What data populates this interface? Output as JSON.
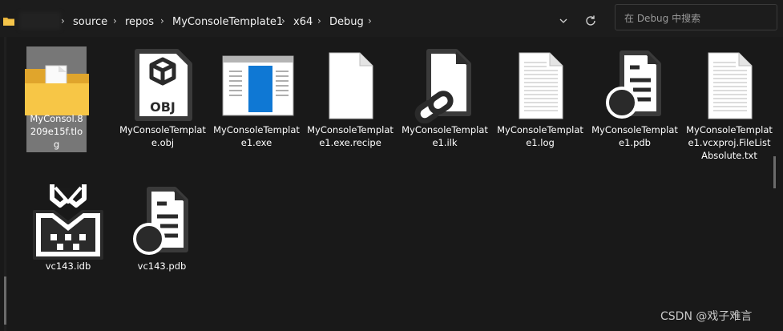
{
  "breadcrumb": {
    "items": [
      "source",
      "repos",
      "MyConsoleTemplate1",
      "x64",
      "Debug"
    ]
  },
  "search": {
    "placeholder": "在 Debug 中搜索"
  },
  "files": [
    {
      "name": "MyConsol.8209e15f.tlog",
      "icon": "folder-icon",
      "selected": true
    },
    {
      "name": "MyConsoleTemplate.obj",
      "icon": "obj-file-icon",
      "selected": false
    },
    {
      "name": "MyConsoleTemplate1.exe",
      "icon": "exe-file-icon",
      "selected": false
    },
    {
      "name": "MyConsoleTemplate1.exe.recipe",
      "icon": "blank-file-icon",
      "selected": false
    },
    {
      "name": "MyConsoleTemplate1.ilk",
      "icon": "linked-file-icon",
      "selected": false
    },
    {
      "name": "MyConsoleTemplate1.log",
      "icon": "text-file-icon",
      "selected": false
    },
    {
      "name": "MyConsoleTemplate1.pdb",
      "icon": "pdb-file-icon",
      "selected": false
    },
    {
      "name": "MyConsoleTemplate1.vcxproj.FileListAbsolute.txt",
      "icon": "text-file-icon",
      "selected": false
    },
    {
      "name": "vc143.idb",
      "icon": "idb-file-icon",
      "selected": false
    },
    {
      "name": "vc143.pdb",
      "icon": "pdb-file-icon",
      "selected": false
    }
  ],
  "icon_labels": {
    "obj": "OBJ"
  },
  "watermark": "CSDN @戏子难言"
}
